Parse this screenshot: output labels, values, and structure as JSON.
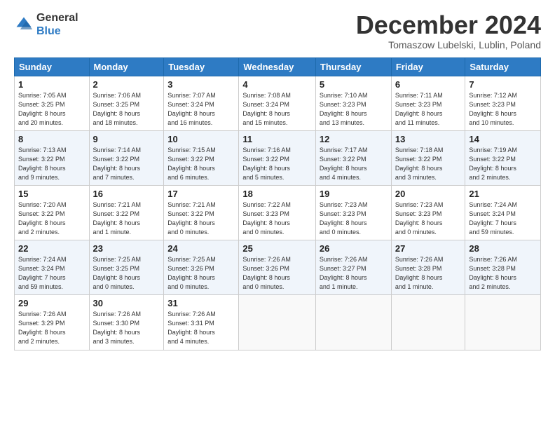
{
  "header": {
    "logo_general": "General",
    "logo_blue": "Blue",
    "month_title": "December 2024",
    "location": "Tomaszow Lubelski, Lublin, Poland"
  },
  "days_of_week": [
    "Sunday",
    "Monday",
    "Tuesday",
    "Wednesday",
    "Thursday",
    "Friday",
    "Saturday"
  ],
  "weeks": [
    [
      {
        "day": "1",
        "info": "Sunrise: 7:05 AM\nSunset: 3:25 PM\nDaylight: 8 hours\nand 20 minutes."
      },
      {
        "day": "2",
        "info": "Sunrise: 7:06 AM\nSunset: 3:25 PM\nDaylight: 8 hours\nand 18 minutes."
      },
      {
        "day": "3",
        "info": "Sunrise: 7:07 AM\nSunset: 3:24 PM\nDaylight: 8 hours\nand 16 minutes."
      },
      {
        "day": "4",
        "info": "Sunrise: 7:08 AM\nSunset: 3:24 PM\nDaylight: 8 hours\nand 15 minutes."
      },
      {
        "day": "5",
        "info": "Sunrise: 7:10 AM\nSunset: 3:23 PM\nDaylight: 8 hours\nand 13 minutes."
      },
      {
        "day": "6",
        "info": "Sunrise: 7:11 AM\nSunset: 3:23 PM\nDaylight: 8 hours\nand 11 minutes."
      },
      {
        "day": "7",
        "info": "Sunrise: 7:12 AM\nSunset: 3:23 PM\nDaylight: 8 hours\nand 10 minutes."
      }
    ],
    [
      {
        "day": "8",
        "info": "Sunrise: 7:13 AM\nSunset: 3:22 PM\nDaylight: 8 hours\nand 9 minutes."
      },
      {
        "day": "9",
        "info": "Sunrise: 7:14 AM\nSunset: 3:22 PM\nDaylight: 8 hours\nand 7 minutes."
      },
      {
        "day": "10",
        "info": "Sunrise: 7:15 AM\nSunset: 3:22 PM\nDaylight: 8 hours\nand 6 minutes."
      },
      {
        "day": "11",
        "info": "Sunrise: 7:16 AM\nSunset: 3:22 PM\nDaylight: 8 hours\nand 5 minutes."
      },
      {
        "day": "12",
        "info": "Sunrise: 7:17 AM\nSunset: 3:22 PM\nDaylight: 8 hours\nand 4 minutes."
      },
      {
        "day": "13",
        "info": "Sunrise: 7:18 AM\nSunset: 3:22 PM\nDaylight: 8 hours\nand 3 minutes."
      },
      {
        "day": "14",
        "info": "Sunrise: 7:19 AM\nSunset: 3:22 PM\nDaylight: 8 hours\nand 2 minutes."
      }
    ],
    [
      {
        "day": "15",
        "info": "Sunrise: 7:20 AM\nSunset: 3:22 PM\nDaylight: 8 hours\nand 2 minutes."
      },
      {
        "day": "16",
        "info": "Sunrise: 7:21 AM\nSunset: 3:22 PM\nDaylight: 8 hours\nand 1 minute."
      },
      {
        "day": "17",
        "info": "Sunrise: 7:21 AM\nSunset: 3:22 PM\nDaylight: 8 hours\nand 0 minutes."
      },
      {
        "day": "18",
        "info": "Sunrise: 7:22 AM\nSunset: 3:23 PM\nDaylight: 8 hours\nand 0 minutes."
      },
      {
        "day": "19",
        "info": "Sunrise: 7:23 AM\nSunset: 3:23 PM\nDaylight: 8 hours\nand 0 minutes."
      },
      {
        "day": "20",
        "info": "Sunrise: 7:23 AM\nSunset: 3:23 PM\nDaylight: 8 hours\nand 0 minutes."
      },
      {
        "day": "21",
        "info": "Sunrise: 7:24 AM\nSunset: 3:24 PM\nDaylight: 7 hours\nand 59 minutes."
      }
    ],
    [
      {
        "day": "22",
        "info": "Sunrise: 7:24 AM\nSunset: 3:24 PM\nDaylight: 7 hours\nand 59 minutes."
      },
      {
        "day": "23",
        "info": "Sunrise: 7:25 AM\nSunset: 3:25 PM\nDaylight: 8 hours\nand 0 minutes."
      },
      {
        "day": "24",
        "info": "Sunrise: 7:25 AM\nSunset: 3:26 PM\nDaylight: 8 hours\nand 0 minutes."
      },
      {
        "day": "25",
        "info": "Sunrise: 7:26 AM\nSunset: 3:26 PM\nDaylight: 8 hours\nand 0 minutes."
      },
      {
        "day": "26",
        "info": "Sunrise: 7:26 AM\nSunset: 3:27 PM\nDaylight: 8 hours\nand 1 minute."
      },
      {
        "day": "27",
        "info": "Sunrise: 7:26 AM\nSunset: 3:28 PM\nDaylight: 8 hours\nand 1 minute."
      },
      {
        "day": "28",
        "info": "Sunrise: 7:26 AM\nSunset: 3:28 PM\nDaylight: 8 hours\nand 2 minutes."
      }
    ],
    [
      {
        "day": "29",
        "info": "Sunrise: 7:26 AM\nSunset: 3:29 PM\nDaylight: 8 hours\nand 2 minutes."
      },
      {
        "day": "30",
        "info": "Sunrise: 7:26 AM\nSunset: 3:30 PM\nDaylight: 8 hours\nand 3 minutes."
      },
      {
        "day": "31",
        "info": "Sunrise: 7:26 AM\nSunset: 3:31 PM\nDaylight: 8 hours\nand 4 minutes."
      },
      {
        "day": "",
        "info": ""
      },
      {
        "day": "",
        "info": ""
      },
      {
        "day": "",
        "info": ""
      },
      {
        "day": "",
        "info": ""
      }
    ]
  ]
}
